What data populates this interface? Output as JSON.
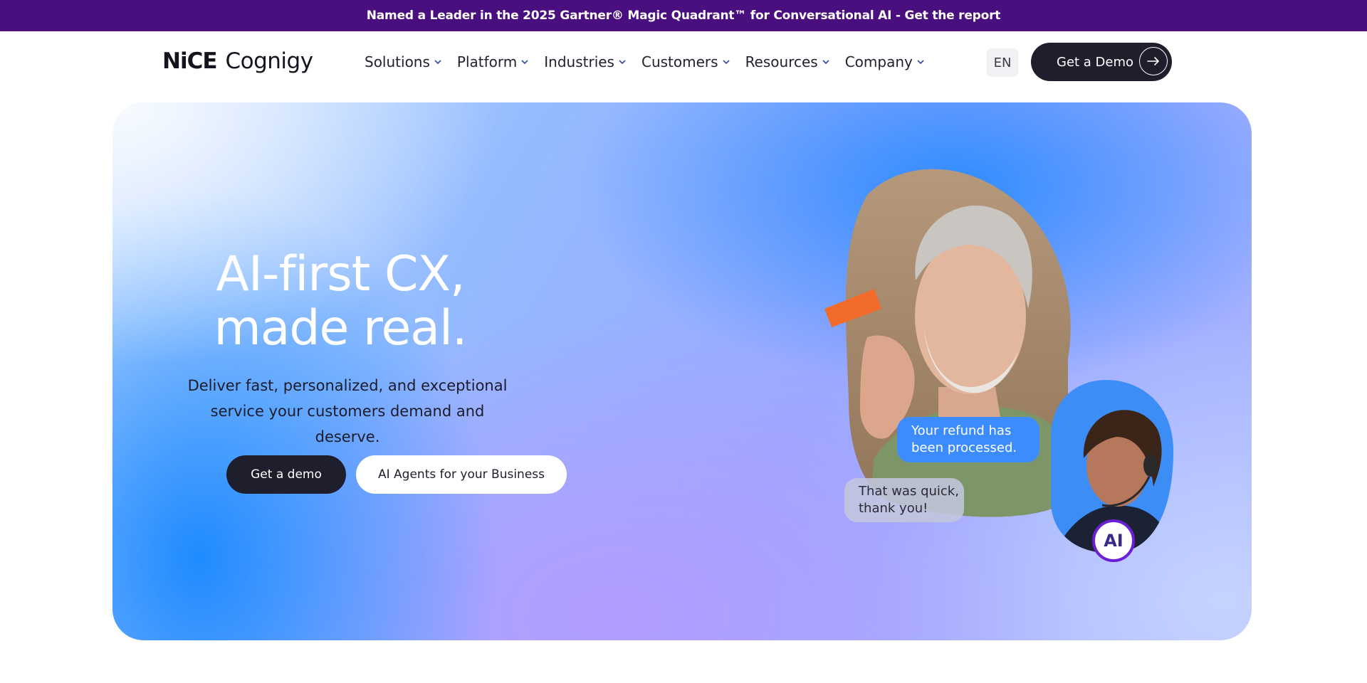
{
  "banner": {
    "text": "Named a Leader in the 2025 Gartner® Magic Quadrant™ for Conversational AI - Get the report"
  },
  "nav": {
    "logo_primary": "NiCE",
    "logo_secondary": "Cognigy",
    "menu": [
      {
        "label": "Solutions"
      },
      {
        "label": "Platform"
      },
      {
        "label": "Industries"
      },
      {
        "label": "Customers"
      },
      {
        "label": "Resources"
      },
      {
        "label": "Company"
      }
    ],
    "language": "EN",
    "cta_label": "Get a Demo"
  },
  "hero": {
    "headline_line1": "AI-first CX,",
    "headline_line2": "made real.",
    "subtitle": "Deliver fast, personalized, and exceptional service your customers demand and deserve.",
    "primary_button": "Get a demo",
    "secondary_button": "AI Agents for your Business",
    "chat": {
      "agent_message_line1": "Your refund has",
      "agent_message_line2": "been processed.",
      "customer_message_line1": "That was quick,",
      "customer_message_line2": "thank you!",
      "ai_badge": "AI"
    }
  },
  "colors": {
    "banner_bg": "#4a0f7e",
    "dark_button": "#1e1e2c",
    "agent_bubble": "#3c8cff",
    "ai_badge_ring": "#6a1fd6"
  },
  "icons": {
    "menu_chevron": "chevron-down-icon",
    "cta_arrow": "arrow-right-icon"
  }
}
